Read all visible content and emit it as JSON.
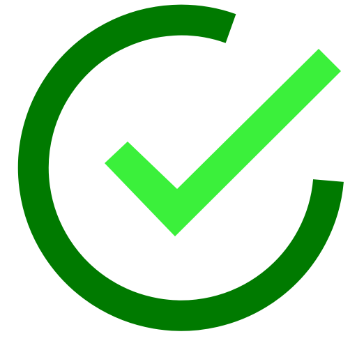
{
  "icon": {
    "name": "check-circle-icon",
    "ring_color": "#007A00",
    "check_color": "#3BF03B",
    "background": "#FFFFFF"
  }
}
